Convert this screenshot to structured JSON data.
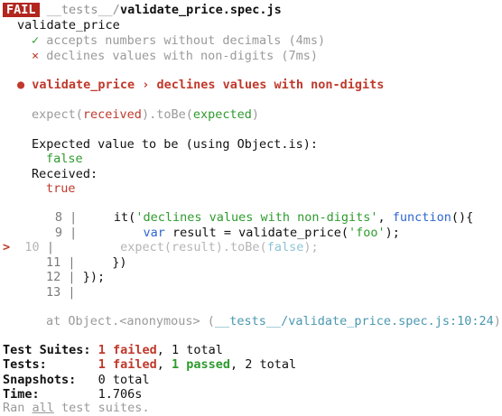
{
  "header": {
    "badge": "FAIL",
    "path_dir": "__tests__/",
    "path_file": "validate_price.spec.js"
  },
  "suite": {
    "name": "validate_price",
    "tests": [
      {
        "mark": "✓",
        "label": "accepts numbers without decimals (4ms)",
        "status": "passed"
      },
      {
        "mark": "×",
        "label": "declines values with non-digits (7ms)",
        "status": "failed"
      }
    ]
  },
  "error": {
    "bullet": "●",
    "title": "validate_price › declines values with non-digits",
    "expect_line": {
      "p1": "expect(",
      "received": "received",
      "p2": ").toBe(",
      "expected": "expected",
      "p3": ")"
    },
    "expected_label": "Expected value to be (using Object.is):",
    "expected_value": "false",
    "received_label": "Received:",
    "received_value": "true",
    "code": {
      "pointer": ">",
      "lines": [
        {
          "num": "8",
          "pipe": "|"
        },
        {
          "num": "9",
          "pipe": "|"
        },
        {
          "num": "10",
          "pipe": "|"
        },
        {
          "num": "11",
          "pipe": "|"
        },
        {
          "num": "12",
          "pipe": "|"
        },
        {
          "num": "13",
          "pipe": "|"
        }
      ],
      "l8": {
        "a": "it(",
        "str": "'declines values with non-digits'",
        "b": ", ",
        "kw": "function",
        "c": "(){"
      },
      "l9": {
        "kw": "var",
        "a": " result = validate_price(",
        "str": "'foo'",
        "b": ");"
      },
      "l10": {
        "a": "expect(result)",
        "b": ".toBe(",
        "val": "false",
        "c": ");"
      },
      "l11": {
        "a": "})"
      },
      "l12": {
        "a": "});"
      }
    },
    "stack": {
      "prefix": "at Object.<anonymous> (",
      "location": "__tests__/validate_price.spec.js:10:24",
      "suffix": ")"
    }
  },
  "summary": {
    "suites": {
      "label": "Test Suites:",
      "failed": "1 failed",
      "rest": ", 1 total"
    },
    "tests": {
      "label": "Tests:",
      "failed": "1 failed",
      "sep": ", ",
      "passed": "1 passed",
      "rest": ", 2 total"
    },
    "snapshots": {
      "label": "Snapshots:",
      "value": "0 total"
    },
    "time": {
      "label": "Time:",
      "value": "1.706s"
    },
    "footer": {
      "a": "Ran ",
      "b": "all",
      "c": " test suites."
    }
  }
}
